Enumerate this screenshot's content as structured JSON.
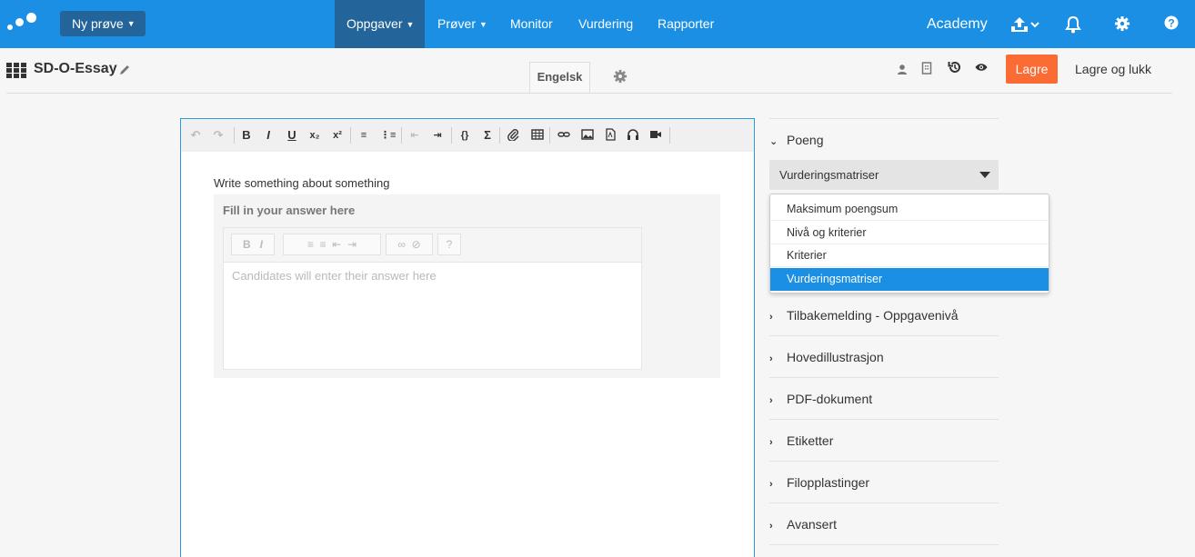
{
  "nav": {
    "new_test": "Ny prøve",
    "links": [
      {
        "label": "Oppgaver",
        "dropdown": true,
        "active": true
      },
      {
        "label": "Prøver",
        "dropdown": true,
        "active": false
      },
      {
        "label": "Monitor",
        "dropdown": false,
        "active": false
      },
      {
        "label": "Vurdering",
        "dropdown": false,
        "active": false
      },
      {
        "label": "Rapporter",
        "dropdown": false,
        "active": false
      }
    ],
    "academy": "Academy",
    "icons": [
      "upload-icon",
      "bell-icon",
      "gear-icon",
      "help-icon"
    ]
  },
  "titlebar": {
    "title": "SD-O-Essay",
    "language_tab": "Engelsk",
    "save": "Lagre",
    "save_close": "Lagre og lukk"
  },
  "editor": {
    "prompt": "Write something about something",
    "answer_title": "Fill in your answer here",
    "answer_placeholder": "Candidates will enter their answer here"
  },
  "panel": {
    "section_open": "Poeng",
    "select_value": "Vurderingsmatriser",
    "options": [
      "Maksimum poengsum",
      "Nivå og kriterier",
      "Kriterier",
      "Vurderingsmatriser"
    ],
    "selected_index": 3,
    "sections": [
      "Tilbakemelding - Oppgavenivå",
      "Hovedillustrasjon",
      "PDF-dokument",
      "Etiketter",
      "Filopplastinger",
      "Avansert"
    ]
  },
  "colors": {
    "nav_bg": "#1a8fe3",
    "nav_active": "#23649a",
    "save_button": "#fb6b34",
    "selected_option": "#1a8fe3"
  }
}
